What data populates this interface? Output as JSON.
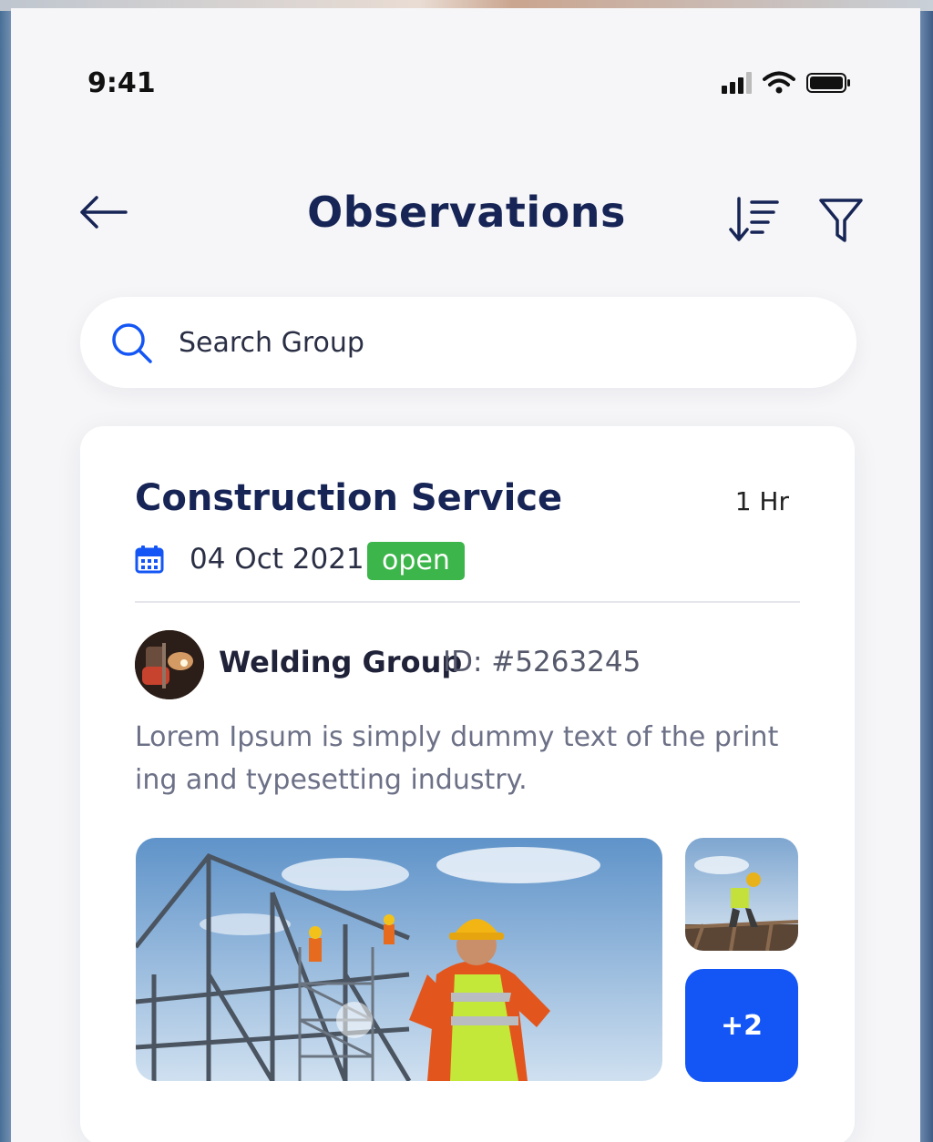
{
  "status_bar": {
    "time": "9:41",
    "icons": [
      "signal-icon",
      "wifi-icon",
      "battery-icon"
    ]
  },
  "header": {
    "title": "Observations",
    "back_icon": "arrow-left-icon",
    "sort_icon": "sort-descending-icon",
    "filter_icon": "filter-icon"
  },
  "search": {
    "placeholder": "Search Group",
    "value": ""
  },
  "card": {
    "title": "Construction Service",
    "time_ago": "1 Hr",
    "date": "04 Oct 2021",
    "status": "open",
    "group": {
      "name": "Welding Group",
      "id": "ID: #5263245"
    },
    "description": "Lorem Ipsum is simply dummy text of the print ing and typesetting industry.",
    "more_photos_label": "+2"
  },
  "colors": {
    "primary_text": "#172556",
    "status_open": "#3cb54a",
    "accent_blue": "#1456f5",
    "background": "#f6f6f8"
  }
}
